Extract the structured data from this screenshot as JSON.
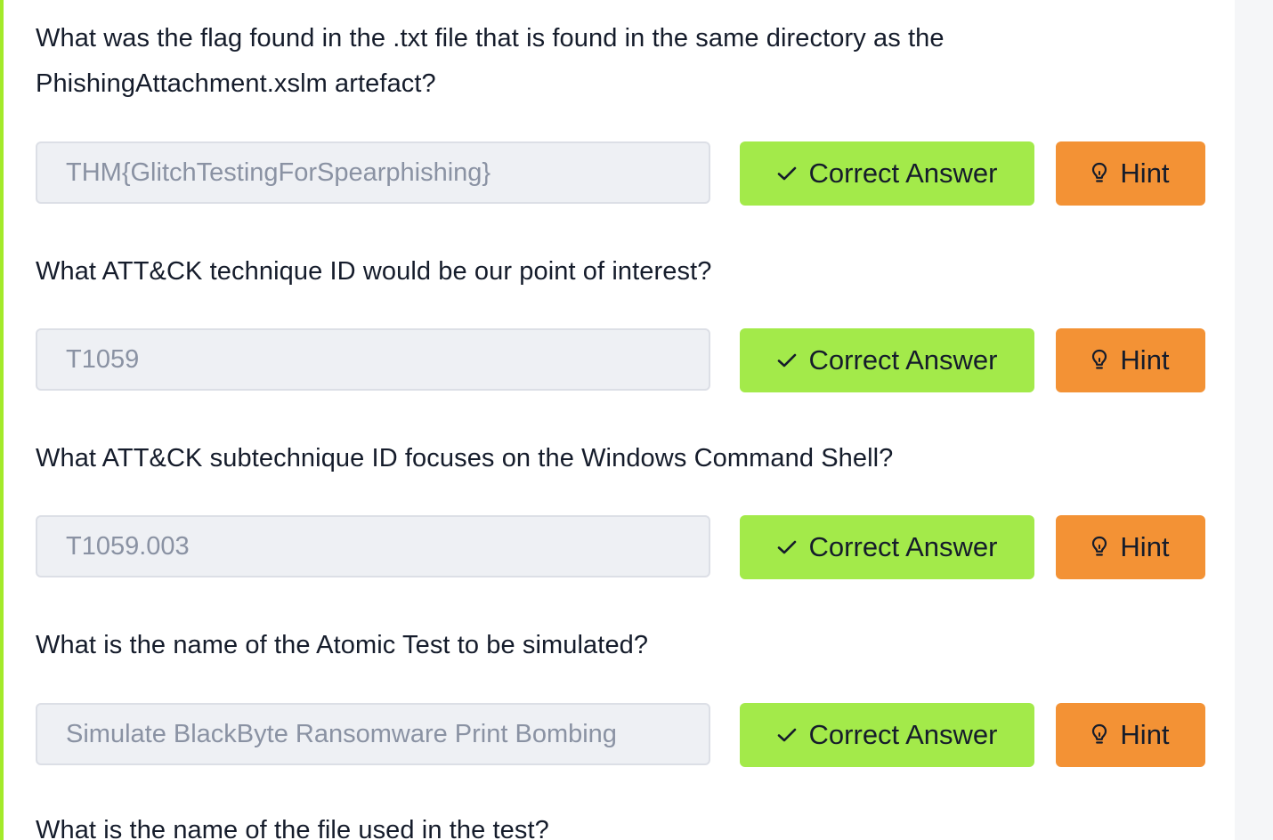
{
  "questions": [
    {
      "line1": "What was the flag found in the .txt file that is found in the same directory as the",
      "line2": "PhishingAttachment.xslm artefact?",
      "answer": "THM{GlitchTestingForSpearphishing}"
    },
    {
      "line1": "What ATT&CK technique ID would be our point of interest?",
      "answer": "T1059"
    },
    {
      "line1": "What ATT&CK subtechnique ID focuses on the Windows Command Shell?",
      "answer": "T1059.003"
    },
    {
      "line1": "What is the name of the Atomic Test to be simulated?",
      "answer": "Simulate BlackByte Ransomware Print Bombing"
    },
    {
      "line1": "What is the name of the file used in the test?"
    }
  ],
  "buttons": {
    "correct_label": "Correct Answer",
    "hint_label": "Hint"
  },
  "colors": {
    "accent_bar": "#a3ea2a",
    "correct_button": "#a3ea4a",
    "hint_button": "#f39235",
    "input_background": "#eef0f4",
    "input_text": "#8a92a3",
    "question_text": "#151c2b"
  },
  "icons": {
    "correct": "check-icon",
    "hint": "lightbulb-icon"
  }
}
